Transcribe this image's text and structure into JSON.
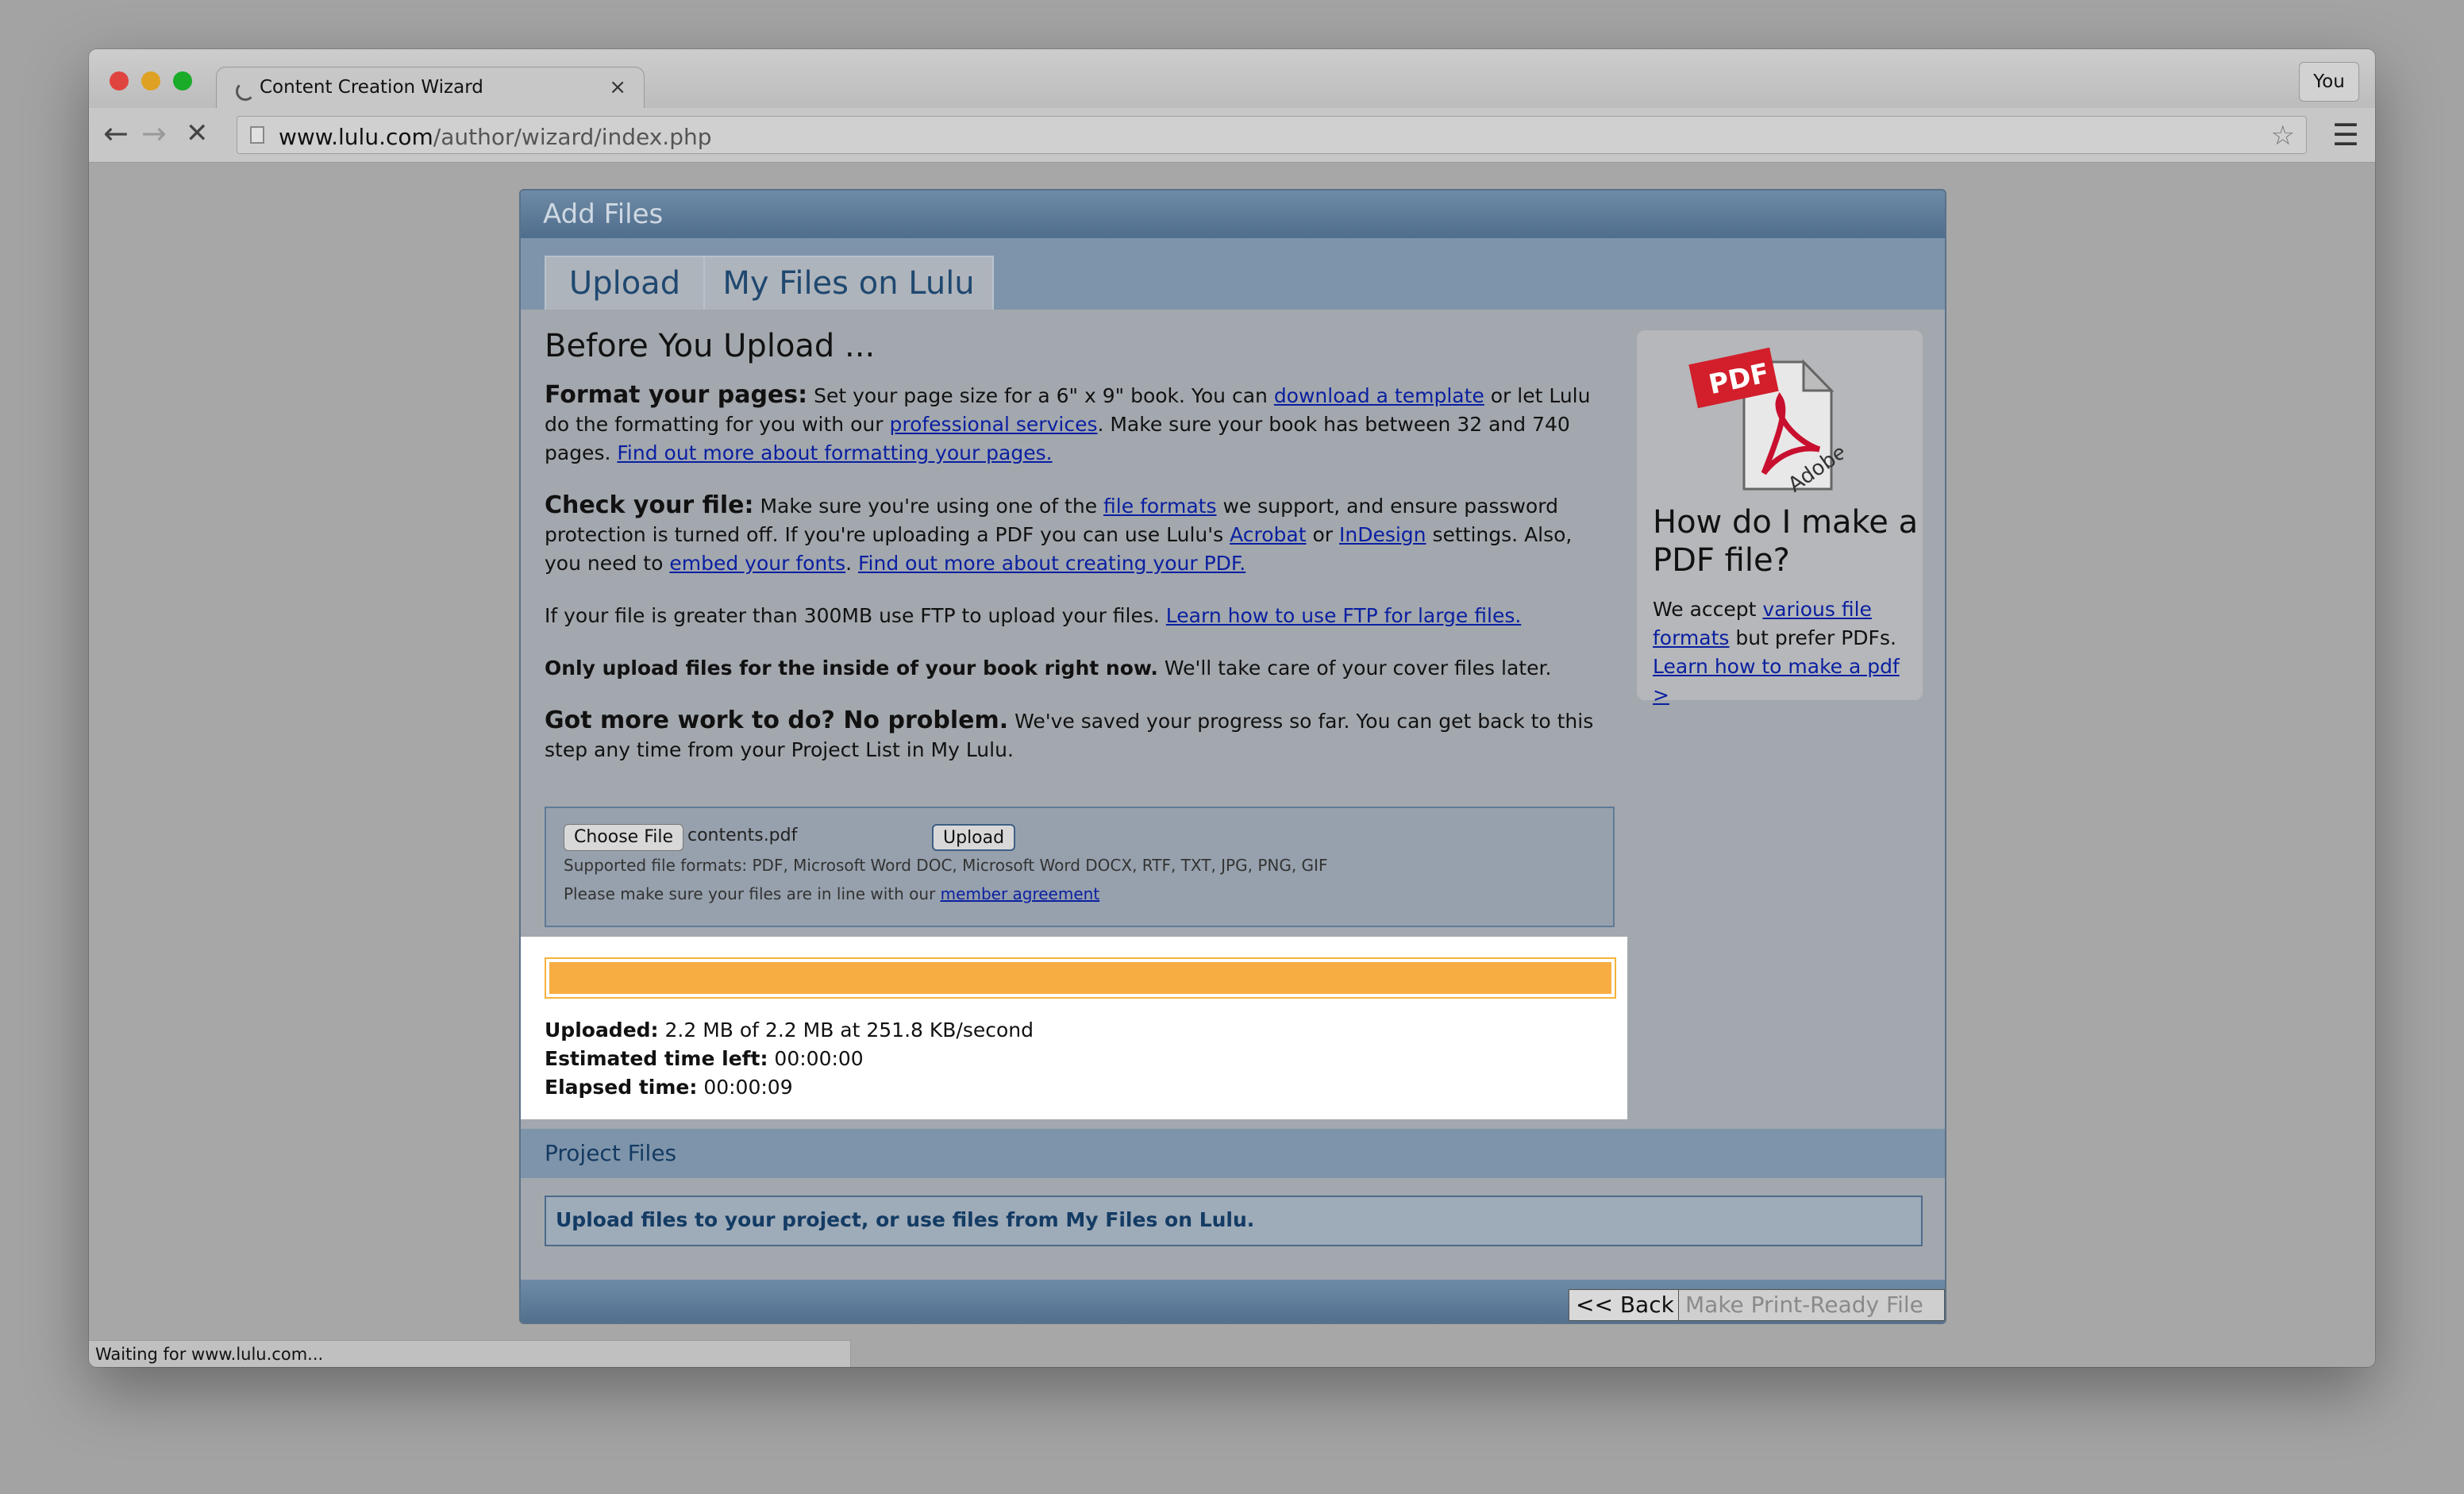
{
  "browser": {
    "tab_title": "Content Creation Wizard",
    "tab_close": "×",
    "profile_label": "You",
    "url_host": "www.lulu.com",
    "url_path": "/author/wizard/index.php",
    "status_text": "Waiting for www.lulu.com..."
  },
  "wizard": {
    "panel_title": "Add Files",
    "tabs": [
      "Upload",
      "My Files on Lulu"
    ],
    "heading": "Before You Upload ...",
    "format": {
      "lead": "Format your pages:",
      "t1": " Set your page size for a 6\" x 9\" book. You can ",
      "link1": "download a template",
      "t2": " or let Lulu do the formatting for you with our ",
      "link2": "professional services",
      "t3": ". Make sure your book has between 32 and 740 pages. ",
      "link3": "Find out more about formatting your pages."
    },
    "check": {
      "lead": "Check your file:",
      "t1": " Make sure you're using one of the ",
      "link1": "file formats",
      "t2": " we support, and ensure password protection is turned off. If you're uploading a PDF you can use Lulu's ",
      "link2": "Acrobat",
      "t3": " or ",
      "link3": "InDesign",
      "t4": " settings. Also, you need to ",
      "link4": "embed your fonts",
      "t5": ". ",
      "link5": "Find out more about creating your PDF."
    },
    "ftp": {
      "t1": "If your file is greater than 300MB use FTP to upload your files. ",
      "link": "Learn how to use FTP for large files."
    },
    "inside": {
      "bold": "Only upload files for the inside of your book right now.",
      "t1": " We'll take care of your cover files later."
    },
    "more": {
      "lead": "Got more work to do? No problem.",
      "t1": " We've saved your progress so far. You can get back to this step any time from your Project List in My Lulu."
    },
    "upload": {
      "choose_label": "Choose File",
      "filename": "contents.pdf",
      "upload_label": "Upload",
      "supported": "Supported file formats: PDF, Microsoft Word DOC, Microsoft Word DOCX, RTF, TXT, JPG, PNG, GIF",
      "agreement_text": "Please make sure your files are in line with our ",
      "agreement_link": "member agreement"
    },
    "progress": {
      "percent": 100,
      "uploaded_label": "Uploaded:",
      "uploaded_value": " 2.2 MB of 2.2 MB at 251.8 KB/second",
      "eta_label": "Estimated time left:",
      "eta_value": " 00:00:00",
      "elapsed_label": "Elapsed time:",
      "elapsed_value": " 00:00:09"
    },
    "sidebar": {
      "icon_badge": "PDF",
      "icon_brand": "Adobe",
      "heading": "How do I make a PDF file?",
      "t1": "We accept ",
      "link1": "various file formats",
      "t2": " but prefer PDFs.",
      "link2": "Learn how to make a pdf >"
    },
    "project_files": {
      "title": "Project Files",
      "message": "Upload files to your project, or use files from My Files on Lulu."
    },
    "footer": {
      "back_label": "<< Back",
      "next_label": "Make Print-Ready File >>"
    }
  },
  "colors": {
    "progress": "#f7ad42",
    "header": "#5b7896",
    "link": "#0a1fa0"
  }
}
